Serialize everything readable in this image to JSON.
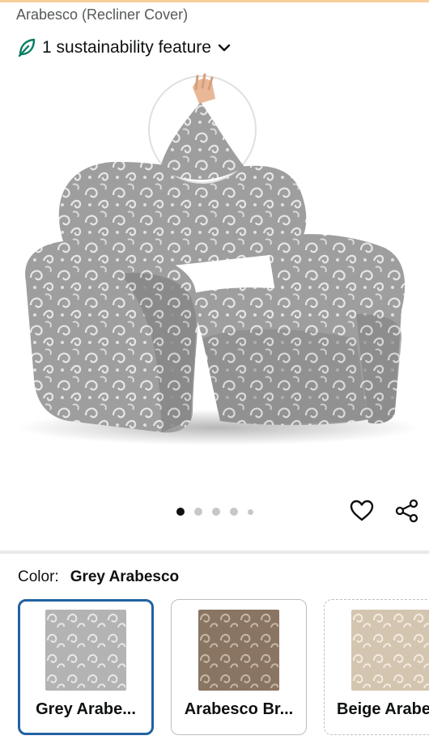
{
  "product": {
    "subtitle": "Arabesco (Recliner Cover)"
  },
  "sustainability": {
    "label": "1 sustainability feature",
    "icon": "leaf-icon",
    "accent_color": "#067d62"
  },
  "gallery": {
    "image_alt": "Grey arabesque patterned recliner cover on a reclining chair",
    "dot_count": 5,
    "active_dot": 1,
    "actions": [
      {
        "icon": "heart-icon",
        "label": "Add to wish list"
      },
      {
        "icon": "share-icon",
        "label": "Share"
      }
    ]
  },
  "color_selector": {
    "label": "Color:",
    "selected_value": "Grey Arabesco",
    "selected_border_color": "#2162a1",
    "options": [
      {
        "name": "Grey Arabe...",
        "swatch_color": "#b3b3b3",
        "pattern_color": "#e8e8e8",
        "selected": true
      },
      {
        "name": "Arabesco Br...",
        "swatch_color": "#8a7563",
        "pattern_color": "#c8b8a5",
        "selected": false
      },
      {
        "name": "Beige Arabe",
        "swatch_color": "#d4c5b0",
        "pattern_color": "#f3ece1",
        "selected": false,
        "unavailable": true
      }
    ]
  }
}
